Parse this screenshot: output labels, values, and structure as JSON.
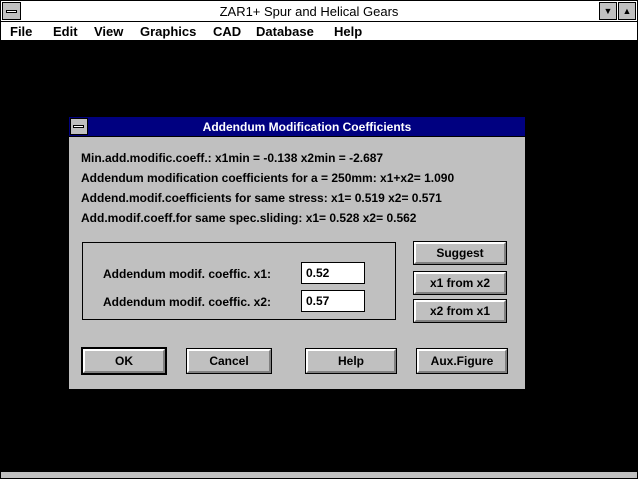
{
  "app": {
    "title": "ZAR1+  Spur and Helical Gears",
    "minimize_glyph": "▼",
    "maximize_glyph": "▲"
  },
  "menu": {
    "items": [
      {
        "label": "File"
      },
      {
        "label": "Edit"
      },
      {
        "label": "View"
      },
      {
        "label": "Graphics"
      },
      {
        "label": "CAD"
      },
      {
        "label": "Database"
      },
      {
        "label": "Help"
      }
    ]
  },
  "dialog": {
    "title": "Addendum Modification Coefficients",
    "info_lines": [
      "Min.add.modific.coeff.: x1min =  -0.138   x2min =  -2.687",
      "Addendum modification coefficients for a = 250mm:    x1+x2= 1.090",
      "Addend.modif.coefficients for same stress: x1= 0.519  x2= 0.571",
      "Add.modif.coeff.for same spec.sliding: x1= 0.528  x2= 0.562"
    ],
    "x1_label": "Addendum modif. coeffic.  x1:",
    "x1_value": "0.52",
    "x2_label": "Addendum modif. coeffic.  x2:",
    "x2_value": "0.57",
    "buttons": {
      "suggest": "Suggest",
      "x1_from_x2": "x1 from x2",
      "x2_from_x1": "x2 from x1",
      "ok": "OK",
      "cancel": "Cancel",
      "help": "Help",
      "aux_figure": "Aux.Figure"
    }
  },
  "colors": {
    "dialog_titlebar": "#000080",
    "face": "#c0c0c0",
    "background": "#000000"
  }
}
